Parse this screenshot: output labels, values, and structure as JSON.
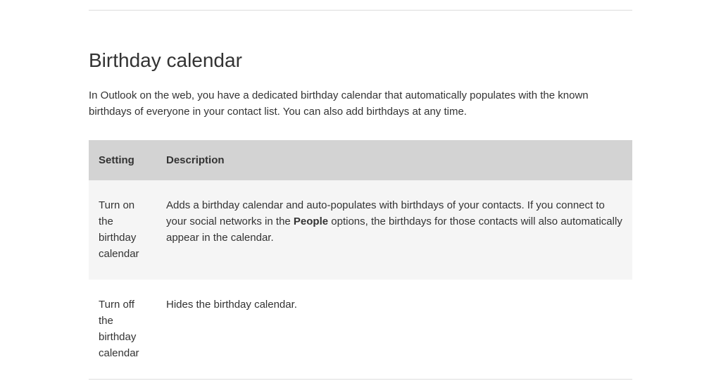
{
  "heading": "Birthday calendar",
  "intro": "In Outlook on the web, you have a dedicated birthday calendar that automatically populates with the known birthdays of everyone in your contact list. You can also add birthdays at any time.",
  "table": {
    "headers": {
      "setting": "Setting",
      "description": "Description"
    },
    "rows": [
      {
        "setting": "Turn on the birthday calendar",
        "desc_before": "Adds a birthday calendar and auto-populates with birthdays of your contacts. If you connect to your social networks in the ",
        "desc_bold": "People",
        "desc_after": " options, the birthdays for those contacts will also automatically appear in the calendar."
      },
      {
        "setting": "Turn off the birthday calendar",
        "desc_before": "Hides the birthday calendar.",
        "desc_bold": "",
        "desc_after": ""
      }
    ]
  }
}
